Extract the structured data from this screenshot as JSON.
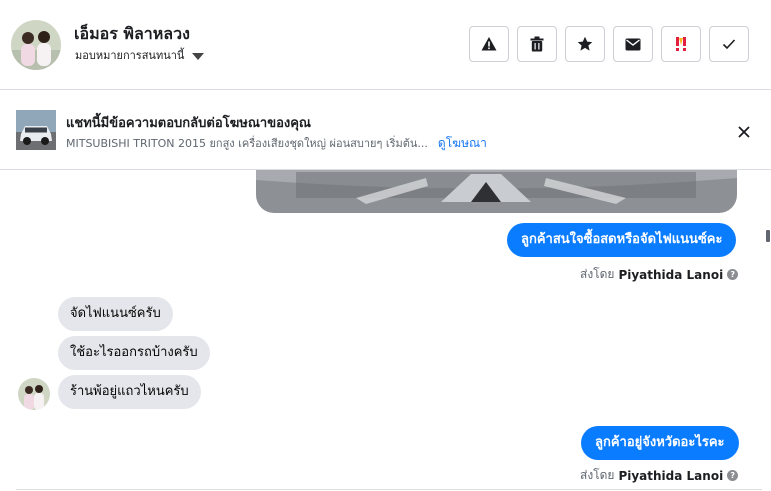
{
  "header": {
    "contact_name": "เอ็มอร พิลาหลวง",
    "assign_label": "มอบหมายการสนทนานี้",
    "actions": [
      {
        "icon": "warning-icon"
      },
      {
        "icon": "trash-icon"
      },
      {
        "icon": "star-icon"
      },
      {
        "icon": "envelope-icon"
      },
      {
        "icon": "follow-up-icon"
      },
      {
        "icon": "checkmark-icon"
      }
    ]
  },
  "ad_banner": {
    "title": "แชทนี้มีข้อความตอบกลับต่อโฆษณาของคุณ",
    "subtitle": "MITSUBISHI TRITON 2015 ยกสูง เครื่องเสียงชุดใหญ่ ผ่อนสบายๆ เริ่มต้น...",
    "link": "ดูโฆษณา"
  },
  "messages": {
    "out_1": "ลูกค้าสนใจซื้อสดหรือจัดไฟแนนซ์คะ",
    "in_1": "จัดไฟแนนซ์ครับ",
    "in_2": "ใช้อะไรออกรถบ้างครับ",
    "in_3": "ร้านพ้อยู่แถวไหนครับ",
    "out_2": "ลูกค้าอยู่จังหวัดอะไรคะ",
    "sent_by_prefix": "ส่งโดย",
    "sender_name": "Piyathida Lanoi"
  },
  "colors": {
    "accent": "#0a7cff",
    "incoming_bubble": "#e4e6eb",
    "link": "#1877f2",
    "follow_up": "#e41e3f"
  }
}
